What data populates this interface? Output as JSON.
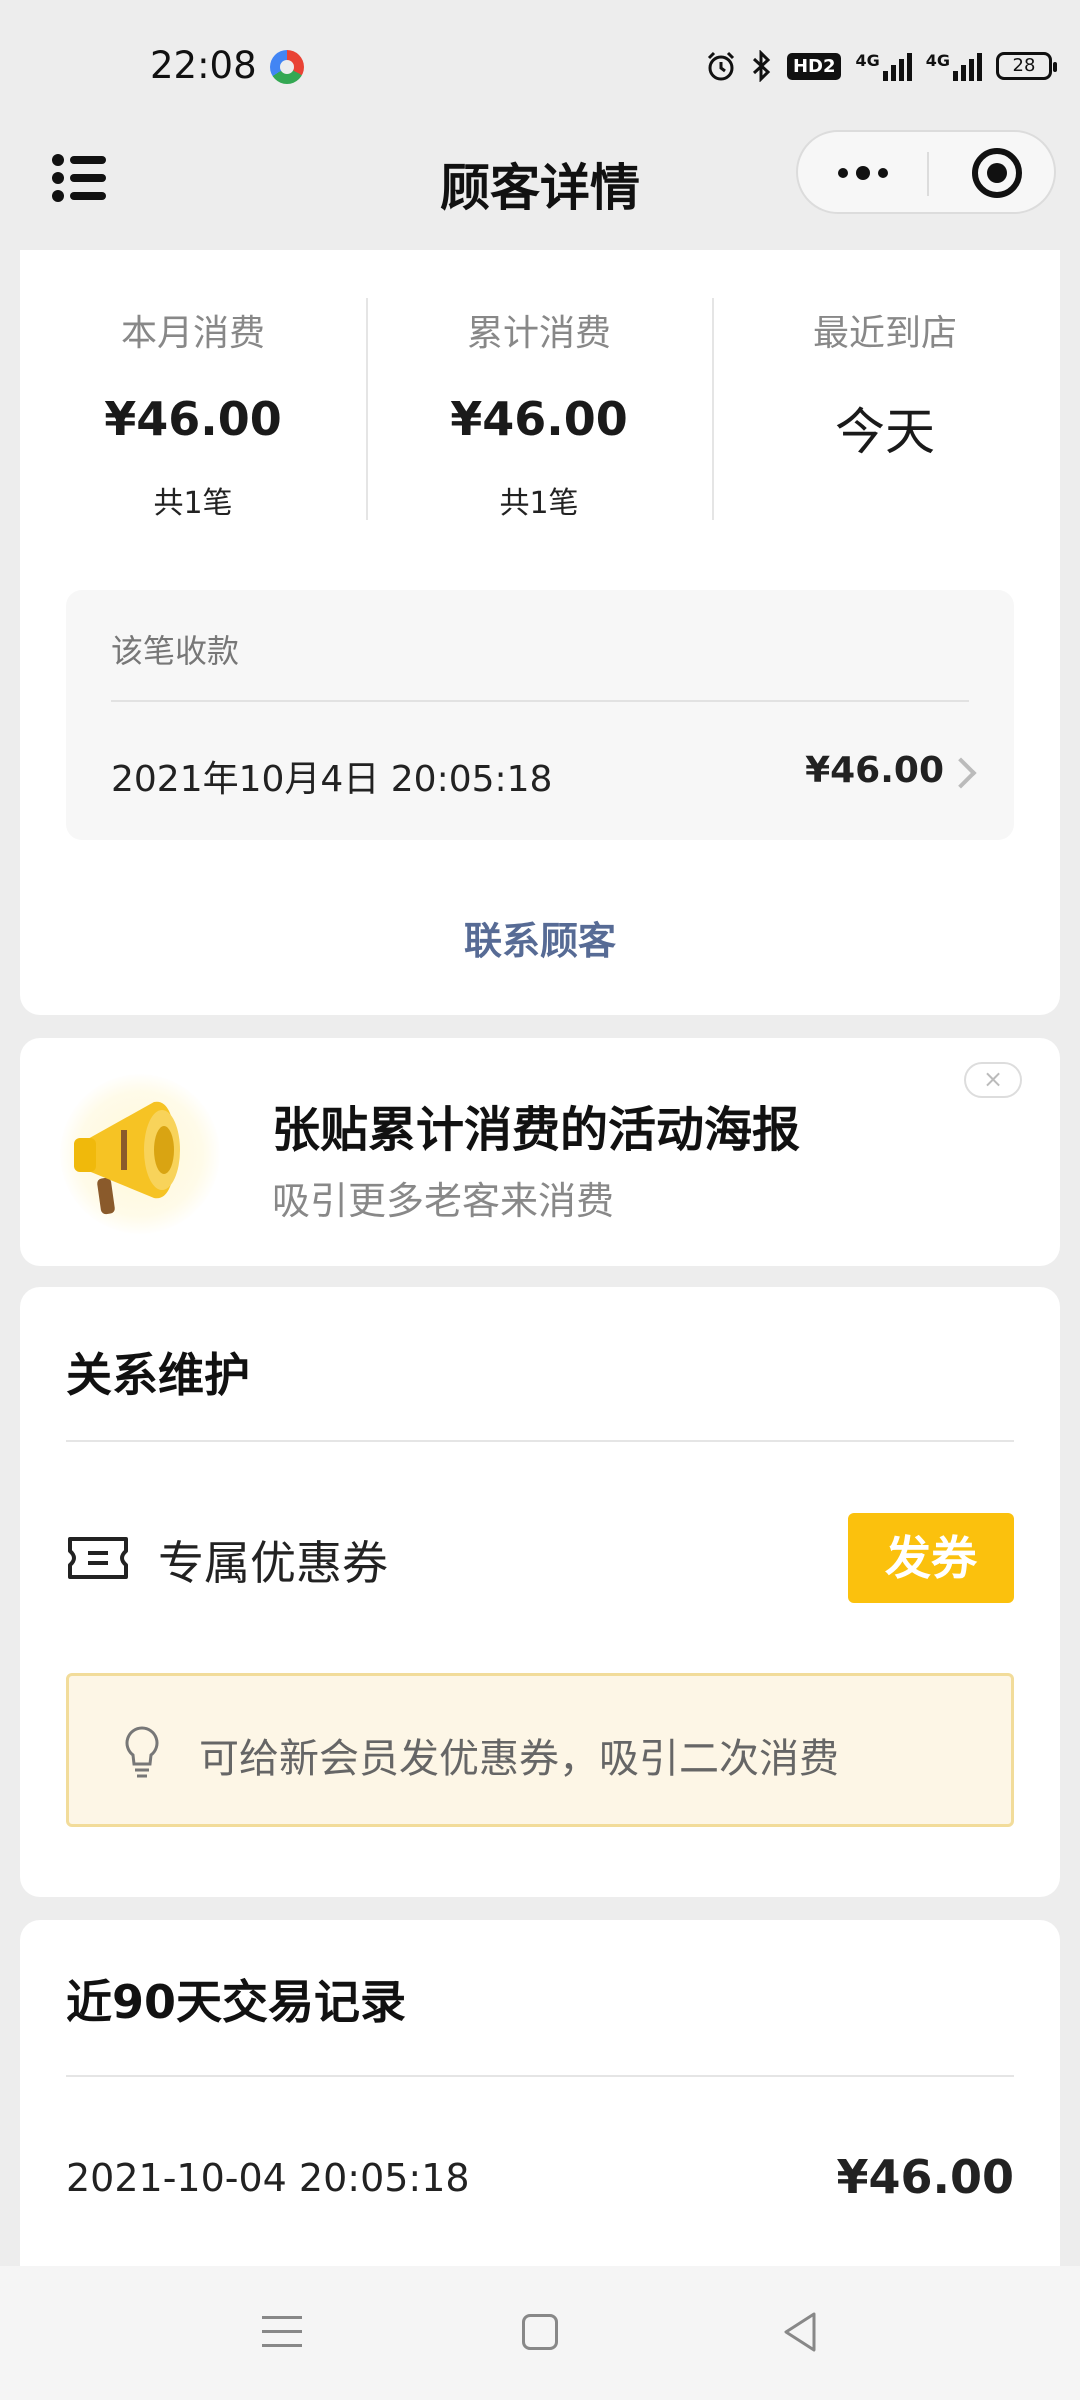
{
  "status_bar": {
    "time": "22:08",
    "signal1_label": "4G",
    "signal2_label": "4G",
    "hd_label": "HD2",
    "battery": "28",
    "icons": [
      "alarm-icon",
      "bluetooth-icon",
      "hd-voice-icon",
      "signal-icon",
      "signal-icon",
      "battery-icon"
    ]
  },
  "nav": {
    "title": "顾客详情",
    "menu_icon": "list-icon",
    "more_icon": "more-dots-icon",
    "close_icon": "target-circle-icon"
  },
  "summary": {
    "stats": [
      {
        "label": "本月消费",
        "value": "¥46.00",
        "sub": "共1笔"
      },
      {
        "label": "累计消费",
        "value": "¥46.00",
        "sub": "共1笔"
      },
      {
        "label": "最近到店",
        "value": "今天",
        "sub": ""
      }
    ],
    "receipt": {
      "title": "该笔收款",
      "datetime": "2021年10月4日 20:05:18",
      "amount": "¥46.00"
    },
    "contact_label": "联系顾客"
  },
  "promo": {
    "title": "张贴累计消费的活动海报",
    "subtitle": "吸引更多老客来消费",
    "icon": "megaphone-icon",
    "close_label": "×"
  },
  "relation": {
    "title": "关系维护",
    "coupon_label": "专属优惠券",
    "coupon_button": "发券",
    "tip_text": "可给新会员发优惠券，吸引二次消费",
    "accent_color": "#fbc10d"
  },
  "records": {
    "title": "近90天交易记录",
    "items": [
      {
        "datetime": "2021-10-04 20:05:18",
        "amount": "¥46.00"
      }
    ]
  }
}
